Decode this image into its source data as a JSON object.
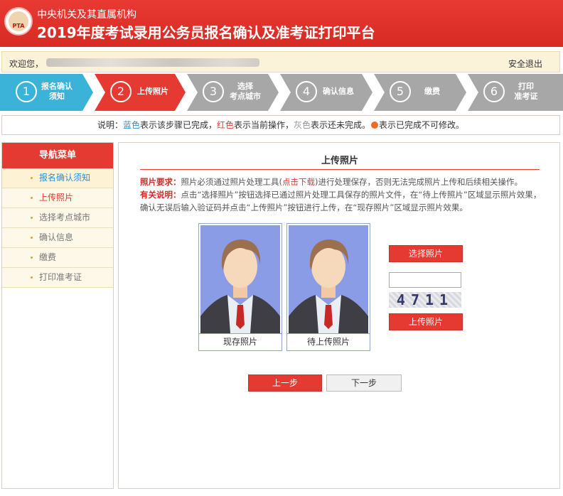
{
  "header": {
    "org": "中央机关及其直属机构",
    "title": "2019年度考试录用公务员报名确认及准考证打印平台",
    "logo_text": "PTA"
  },
  "userbar": {
    "welcome": "欢迎您，",
    "logout": "安全退出"
  },
  "steps": [
    {
      "num": "1",
      "label": "报名确认\n须知",
      "status": "done",
      "color": "#3bb3d9"
    },
    {
      "num": "2",
      "label": "上传照片",
      "status": "current",
      "color": "#e53a32"
    },
    {
      "num": "3",
      "label": "选择\n考点城市",
      "status": "pending",
      "color": "#a7a7a7"
    },
    {
      "num": "4",
      "label": "确认信息",
      "status": "pending",
      "color": "#a7a7a7"
    },
    {
      "num": "5",
      "label": "缴费",
      "status": "pending",
      "color": "#a7a7a7"
    },
    {
      "num": "6",
      "label": "打印\n准考证",
      "status": "pending",
      "color": "#a7a7a7"
    }
  ],
  "legend": {
    "prefix": "说明：",
    "blue_word": "蓝色",
    "blue_text": "表示该步骤已完成，",
    "red_word": "红色",
    "red_text": "表示当前操作，",
    "gray_word": "灰色",
    "gray_text": "表示还未完成。",
    "dot_text": "表示已完成不可修改。"
  },
  "sidebar": {
    "title": "导航菜单",
    "items": [
      {
        "label": "报名确认须知",
        "status": "done"
      },
      {
        "label": "上传照片",
        "status": "current"
      },
      {
        "label": "选择考点城市",
        "status": "pending"
      },
      {
        "label": "确认信息",
        "status": "pending"
      },
      {
        "label": "缴费",
        "status": "pending"
      },
      {
        "label": "打印准考证",
        "status": "pending"
      }
    ]
  },
  "main": {
    "title": "上传照片",
    "req_key": "照片要求：",
    "req_text1": "照片必须通过照片处理工具(",
    "req_link": "点击下载",
    "req_text2": ")进行处理保存，否则无法完成照片上传和后续相关操作。",
    "note_key": "有关说明：",
    "note_text": "点击“选择照片”按钮选择已通过照片处理工具保存的照片文件，在“待上传照片”区域显示照片效果，确认无误后输入验证码并点击“上传照片”按钮进行上传，在“现存照片”区域显示照片效果。",
    "photo_current_caption": "现存照片",
    "photo_pending_caption": "待上传照片",
    "select_photo_button": "选择照片",
    "captcha_value": "",
    "captcha_text": "4711",
    "upload_button": "上传照片",
    "prev_button": "上一步",
    "next_button": "下一步"
  },
  "colors": {
    "brand_red": "#e53a32",
    "done_blue": "#3bb3d9",
    "pending_gray": "#a7a7a7"
  }
}
